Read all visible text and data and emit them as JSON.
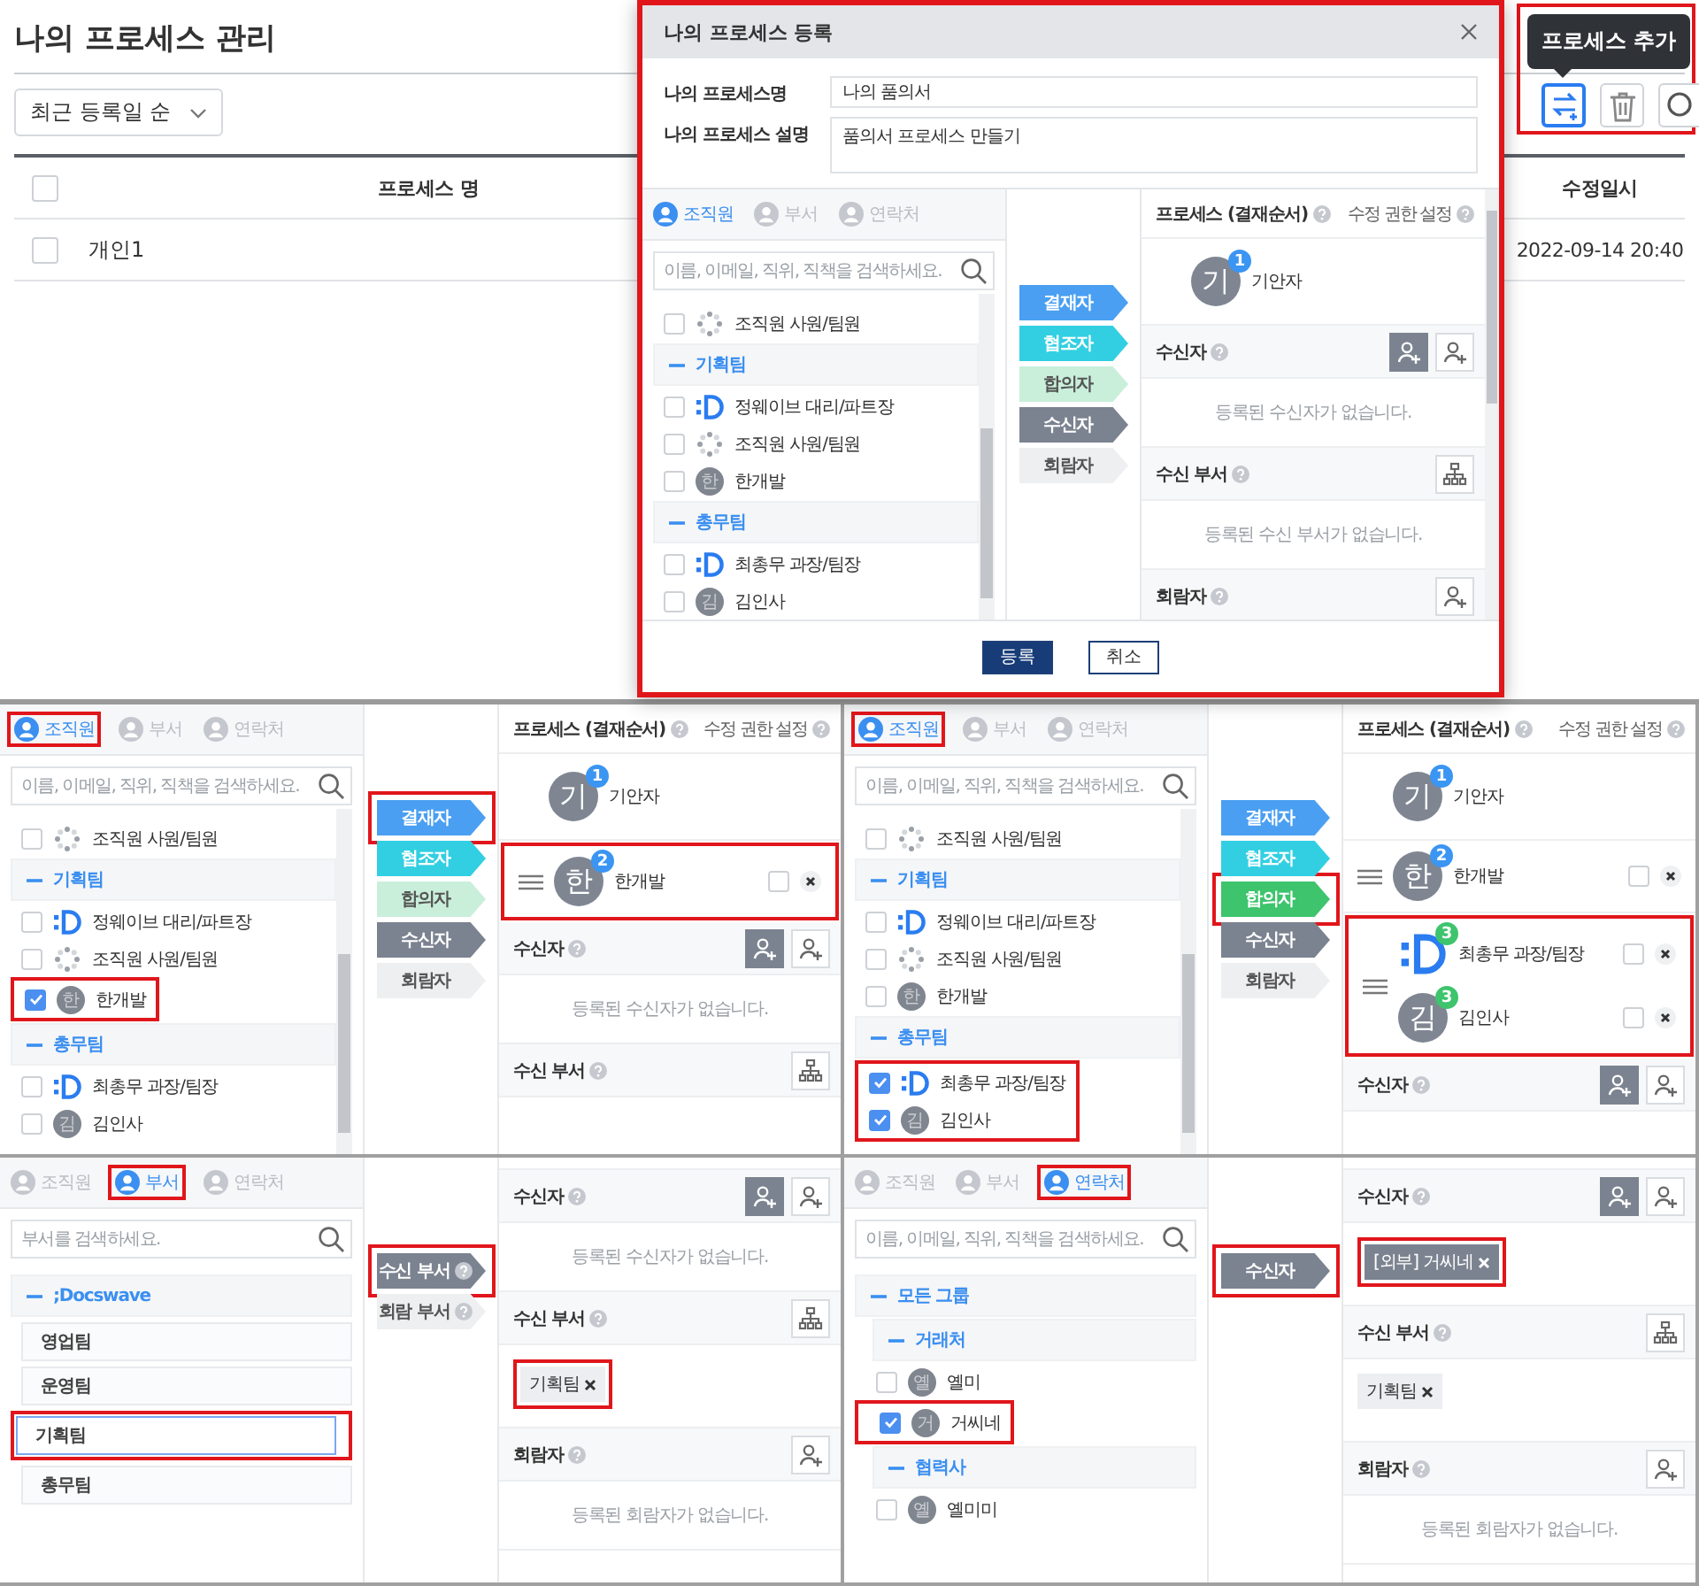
{
  "page": {
    "title": "나의 프로세스 관리",
    "sort": "최근 등록일 순",
    "all_checked": false,
    "columns": [
      "프로세스 명",
      "수정일시"
    ],
    "rows": [
      {
        "name": "개인1",
        "modified": "2022-09-14 20:40",
        "checked": false
      }
    ],
    "toolbar": {
      "highlighted": true,
      "tooltip": "프로세스 추가",
      "buttons": [
        {
          "kind": "add",
          "selected": true
        },
        {
          "kind": "delete",
          "selected": false
        },
        {
          "kind": "search",
          "selected": false
        }
      ]
    }
  },
  "dialog": {
    "title": "나의 프로세스 등록",
    "highlighted": true,
    "fields": [
      {
        "label": "나의 프로세스명",
        "value": "나의 품의서",
        "kind": "input"
      },
      {
        "label": "나의 프로세스 설명",
        "value": "품의서 프로세스 만들기",
        "kind": "textarea"
      }
    ],
    "panel": {
      "tabs": [
        {
          "label": "조직원",
          "selected": true
        },
        {
          "label": "부서",
          "selected": false
        },
        {
          "label": "연락처",
          "selected": false
        }
      ],
      "search": {
        "placeholder": "이름, 이메일, 직위, 직책을 검색하세요."
      },
      "list": [
        {
          "kind": "person",
          "avatar": {
            "kind": "spinner"
          },
          "name": "조직원 사원/팀원",
          "checked": false
        },
        {
          "kind": "group",
          "name": "기획팀"
        },
        {
          "kind": "person",
          "avatar": {
            "kind": "logo"
          },
          "name": "정웨이브 대리/파트장",
          "checked": false
        },
        {
          "kind": "person",
          "avatar": {
            "kind": "spinner"
          },
          "name": "조직원 사원/팀원",
          "checked": false
        },
        {
          "kind": "person",
          "avatar": {
            "kind": "letter",
            "initial": "한"
          },
          "name": "한개발",
          "checked": false
        },
        {
          "kind": "group",
          "name": "총무팀"
        },
        {
          "kind": "person",
          "avatar": {
            "kind": "logo"
          },
          "name": "최총무 과장/팀장",
          "checked": false
        },
        {
          "kind": "person",
          "avatar": {
            "kind": "letter",
            "initial": "김"
          },
          "name": "김인사",
          "checked": false
        }
      ],
      "stages": [
        {
          "label": "결재자",
          "color": "#4a9ff2"
        },
        {
          "label": "협조자",
          "color": "#32cfe2"
        },
        {
          "label": "합의자",
          "color": "#c9efdb"
        },
        {
          "label": "수신자",
          "color": "#7b8290"
        },
        {
          "label": "회람자",
          "color": "#eeeff1"
        }
      ],
      "sections": [
        {
          "kind": "process",
          "title": "프로세스 (결재순서)",
          "help": true,
          "setting": "수정 권한 설정",
          "steps": [
            {
              "kind": "drafter",
              "entries": [
                {
                  "avatar": {
                    "kind": "letter",
                    "initial": "기"
                  },
                  "badge": "1",
                  "color": "#3b95f2",
                  "name": "기안자"
                }
              ]
            }
          ]
        },
        {
          "kind": "recipients",
          "title": "수신자",
          "help": true,
          "actions": [
            {
              "kind": "internal"
            },
            {
              "kind": "external"
            }
          ],
          "empty": "등록된 수신자가 없습니다."
        },
        {
          "kind": "departments",
          "title": "수신 부서",
          "help": true,
          "actions": [
            {
              "kind": "department"
            }
          ],
          "empty": "등록된 수신 부서가 없습니다."
        },
        {
          "kind": "viewers",
          "title": "회람자",
          "help": true,
          "actions": [
            {
              "kind": "external"
            }
          ]
        }
      ]
    },
    "buttons": [
      {
        "label": "등록",
        "kind": "primary"
      },
      {
        "label": "취소",
        "kind": "secondary"
      }
    ]
  },
  "examples": [
    {
      "tabs": [
        {
          "label": "조직원",
          "selected": true,
          "highlighted": true
        },
        {
          "label": "부서",
          "selected": false
        },
        {
          "label": "연락처",
          "selected": false
        }
      ],
      "search": {
        "placeholder": "이름, 이메일, 직위, 직책을 검색하세요."
      },
      "list": [
        {
          "kind": "person",
          "avatar": {
            "kind": "spinner"
          },
          "name": "조직원 사원/팀원",
          "checked": false
        },
        {
          "kind": "group",
          "name": "기획팀"
        },
        {
          "kind": "person",
          "avatar": {
            "kind": "logo"
          },
          "name": "정웨이브 대리/파트장",
          "checked": false
        },
        {
          "kind": "person",
          "avatar": {
            "kind": "spinner"
          },
          "name": "조직원 사원/팀원",
          "checked": false
        },
        {
          "kind": "person",
          "avatar": {
            "kind": "letter",
            "initial": "한"
          },
          "name": "한개발",
          "checked": true,
          "highlighted": true
        },
        {
          "kind": "group",
          "name": "총무팀"
        },
        {
          "kind": "person",
          "avatar": {
            "kind": "logo"
          },
          "name": "최총무 과장/팀장",
          "checked": false
        },
        {
          "kind": "person",
          "avatar": {
            "kind": "letter",
            "initial": "김"
          },
          "name": "김인사",
          "checked": false
        }
      ],
      "stages": [
        {
          "label": "결재자",
          "color": "#4a9ff2",
          "highlighted": true
        },
        {
          "label": "협조자",
          "color": "#32cfe2"
        },
        {
          "label": "합의자",
          "color": "#c9efdb"
        },
        {
          "label": "수신자",
          "color": "#7b8290"
        },
        {
          "label": "회람자",
          "color": "#eeeff1"
        }
      ],
      "sections": [
        {
          "kind": "process",
          "title": "프로세스 (결재순서)",
          "help": true,
          "setting": "수정 권한 설정",
          "steps": [
            {
              "kind": "drafter",
              "entries": [
                {
                  "avatar": {
                    "kind": "letter",
                    "initial": "기"
                  },
                  "badge": "1",
                  "color": "#3b95f2",
                  "name": "기안자"
                }
              ]
            },
            {
              "kind": "approver",
              "highlighted": true,
              "entries": [
                {
                  "avatar": {
                    "kind": "letter",
                    "initial": "한"
                  },
                  "badge": "2",
                  "color": "#3b95f2",
                  "name": "한개발",
                  "checked": false
                }
              ]
            }
          ]
        },
        {
          "kind": "recipients",
          "title": "수신자",
          "help": true,
          "actions": [
            {
              "kind": "internal"
            },
            {
              "kind": "external"
            }
          ],
          "empty": "등록된 수신자가 없습니다."
        },
        {
          "kind": "departments",
          "title": "수신 부서",
          "help": true,
          "actions": [
            {
              "kind": "department"
            }
          ]
        }
      ]
    },
    {
      "tabs": [
        {
          "label": "조직원",
          "selected": true,
          "highlighted": true
        },
        {
          "label": "부서",
          "selected": false
        },
        {
          "label": "연락처",
          "selected": false
        }
      ],
      "search": {
        "placeholder": "이름, 이메일, 직위, 직책을 검색하세요."
      },
      "list": [
        {
          "kind": "person",
          "avatar": {
            "kind": "spinner"
          },
          "name": "조직원 사원/팀원",
          "checked": false
        },
        {
          "kind": "group",
          "name": "기획팀"
        },
        {
          "kind": "person",
          "avatar": {
            "kind": "logo"
          },
          "name": "정웨이브 대리/파트장",
          "checked": false
        },
        {
          "kind": "person",
          "avatar": {
            "kind": "spinner"
          },
          "name": "조직원 사원/팀원",
          "checked": false
        },
        {
          "kind": "person",
          "avatar": {
            "kind": "letter",
            "initial": "한"
          },
          "name": "한개발",
          "checked": false
        },
        {
          "kind": "group",
          "name": "총무팀"
        },
        {
          "kind": "person",
          "avatar": {
            "kind": "logo"
          },
          "name": "최총무 과장/팀장",
          "checked": true,
          "highlighted": true
        },
        {
          "kind": "person",
          "avatar": {
            "kind": "letter",
            "initial": "김"
          },
          "name": "김인사",
          "checked": true,
          "highlighted": true
        }
      ],
      "stages": [
        {
          "label": "결재자",
          "color": "#4a9ff2"
        },
        {
          "label": "협조자",
          "color": "#32cfe2"
        },
        {
          "label": "합의자",
          "color": "#3dc46c",
          "highlighted": true
        },
        {
          "label": "수신자",
          "color": "#7b8290"
        },
        {
          "label": "회람자",
          "color": "#eeeff1"
        }
      ],
      "sections": [
        {
          "kind": "process",
          "title": "프로세스 (결재순서)",
          "help": true,
          "setting": "수정 권한 설정",
          "steps": [
            {
              "kind": "drafter",
              "entries": [
                {
                  "avatar": {
                    "kind": "letter",
                    "initial": "기"
                  },
                  "badge": "1",
                  "color": "#3b95f2",
                  "name": "기안자"
                }
              ]
            },
            {
              "kind": "approver",
              "entries": [
                {
                  "avatar": {
                    "kind": "letter",
                    "initial": "한"
                  },
                  "badge": "2",
                  "color": "#3b95f2",
                  "name": "한개발",
                  "checked": false
                }
              ]
            },
            {
              "kind": "approver",
              "highlighted": true,
              "entries": [
                {
                  "avatar": {
                    "kind": "logo"
                  },
                  "badge": "3",
                  "color": "#3dc46c",
                  "name": "최총무 과장/팀장",
                  "checked": false
                },
                {
                  "avatar": {
                    "kind": "letter",
                    "initial": "김"
                  },
                  "badge": "3",
                  "color": "#3dc46c",
                  "name": "김인사",
                  "checked": false
                }
              ]
            }
          ]
        },
        {
          "kind": "recipients",
          "title": "수신자",
          "help": true,
          "actions": [
            {
              "kind": "internal"
            },
            {
              "kind": "external"
            }
          ]
        }
      ]
    },
    {
      "tabs": [
        {
          "label": "조직원",
          "selected": false
        },
        {
          "label": "부서",
          "selected": true,
          "highlighted": true
        },
        {
          "label": "연락처",
          "selected": false
        }
      ],
      "search": {
        "placeholder": "부서를 검색하세요."
      },
      "list": [
        {
          "kind": "group",
          "name": ";Docswave"
        },
        {
          "kind": "dept",
          "name": "영업팀",
          "selected": false
        },
        {
          "kind": "dept",
          "name": "운영팀",
          "selected": false
        },
        {
          "kind": "dept",
          "name": "기획팀",
          "selected": true,
          "highlighted": true
        },
        {
          "kind": "dept",
          "name": "총무팀",
          "selected": false
        }
      ],
      "stages": [
        {
          "label": "수신 부서",
          "color": "#7b8290",
          "help": true,
          "highlighted": true
        },
        {
          "label": "회람 부서",
          "color": "#eeeff1",
          "help": true
        }
      ],
      "sections": [
        {
          "kind": "recipients",
          "title": "수신자",
          "help": true,
          "actions": [
            {
              "kind": "internal"
            },
            {
              "kind": "external"
            }
          ],
          "empty": "등록된 수신자가 없습니다."
        },
        {
          "kind": "departments",
          "title": "수신 부서",
          "help": true,
          "actions": [
            {
              "kind": "department"
            }
          ],
          "tags": [
            {
              "label": "기획팀",
              "kind": "department",
              "highlighted": true
            }
          ]
        },
        {
          "kind": "viewers",
          "title": "회람자",
          "help": true,
          "actions": [
            {
              "kind": "external"
            }
          ],
          "empty": "등록된 회람자가 없습니다."
        }
      ]
    },
    {
      "tabs": [
        {
          "label": "조직원",
          "selected": false
        },
        {
          "label": "부서",
          "selected": false
        },
        {
          "label": "연락처",
          "selected": true,
          "highlighted": true
        }
      ],
      "search": {
        "placeholder": "이름, 이메일, 직위, 직책을 검색하세요."
      },
      "list": [
        {
          "kind": "group",
          "name": "모든 그룹"
        },
        {
          "kind": "subgroup",
          "name": "거래처"
        },
        {
          "kind": "contact",
          "avatar": {
            "kind": "letter",
            "initial": "옐"
          },
          "name": "옐미",
          "checked": false
        },
        {
          "kind": "contact",
          "avatar": {
            "kind": "letter",
            "initial": "거"
          },
          "name": "거씨네",
          "checked": true,
          "highlighted": true
        },
        {
          "kind": "subgroup",
          "name": "협력사"
        },
        {
          "kind": "contact",
          "avatar": {
            "kind": "letter",
            "initial": "옐"
          },
          "name": "옐미미",
          "checked": false
        }
      ],
      "stages": [
        {
          "label": "수신자",
          "color": "#7b8290",
          "highlighted": true
        }
      ],
      "sections": [
        {
          "kind": "recipients",
          "title": "수신자",
          "help": true,
          "actions": [
            {
              "kind": "internal"
            },
            {
              "kind": "external"
            }
          ],
          "tags": [
            {
              "label": "[외부] 거씨네",
              "kind": "external",
              "highlighted": true
            }
          ]
        },
        {
          "kind": "departments",
          "title": "수신 부서",
          "help": true,
          "actions": [
            {
              "kind": "department"
            }
          ],
          "tags": [
            {
              "label": "기획팀",
              "kind": "department"
            }
          ]
        },
        {
          "kind": "viewers",
          "title": "회람자",
          "help": true,
          "actions": [
            {
              "kind": "external"
            }
          ],
          "empty": "등록된 회람자가 없습니다."
        }
      ]
    }
  ]
}
